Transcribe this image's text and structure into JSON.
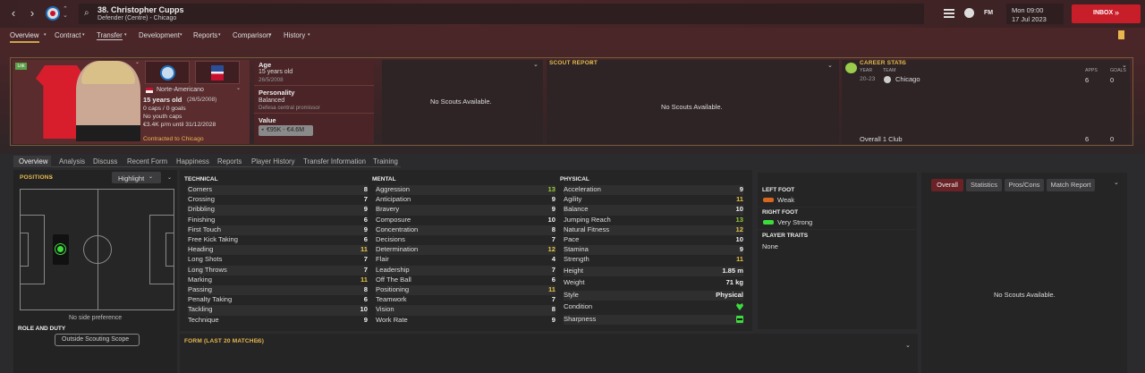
{
  "header": {
    "player_title": "38. Christopher Cupps",
    "player_subtitle": "Defender (Centre) - Chicago",
    "date_day": "Mon 09:00",
    "date_full": "17 Jul 2023",
    "inbox_label": "INBOX",
    "fm_label": "FM"
  },
  "menu": [
    "Overview",
    "Contract",
    "Transfer",
    "Development",
    "Reports",
    "Comparison",
    "History"
  ],
  "profile": {
    "nationality": "Norte-Americano",
    "age_line": "15 years old",
    "age_dob": "(26/5/2008)",
    "caps": "0 caps / 0 goals",
    "youth_caps": "No youth caps",
    "wage": "€3.4K p/m until 31/12/2028",
    "contract": "Contracted to Chicago",
    "badge": "Lnk"
  },
  "info": {
    "age_label": "Age",
    "age_value": "15 years old",
    "dob": "26/5/2008",
    "personality_label": "Personality",
    "personality_value": "Balanced",
    "personality_sub": "Defesa central promissor",
    "value_label": "Value",
    "value_range": "€95K - €4.6M"
  },
  "scouts": {
    "no_scouts_1": "No Scouts Available.",
    "scout_report_label": "SCOUT REPORT",
    "no_scouts_2": "No Scouts Available.",
    "no_scouts_3": "No Scouts Available."
  },
  "career": {
    "label": "CAREER STATS",
    "year_h": "YEAR",
    "team_h": "TEAM",
    "apps_h": "APPS",
    "goals_h": "GOALS",
    "year": "20-23",
    "team": "Chicago",
    "apps": "6",
    "goals": "0",
    "total_label": "Overall 1 Club",
    "total_apps": "6",
    "total_goals": "0"
  },
  "tabs": [
    "Overview",
    "Analysis",
    "Discuss",
    "Recent Form",
    "Happiness",
    "Reports",
    "Player History",
    "Transfer Information",
    "Training"
  ],
  "positions": {
    "label": "POSITIONS",
    "highlight": "Highlight",
    "no_side": "No side preference",
    "role_label": "ROLE AND DUTY",
    "scope_btn": "Outside Scouting Scope"
  },
  "technical": {
    "label": "TECHNICAL",
    "rows": [
      [
        "Corners",
        "8",
        "w"
      ],
      [
        "Crossing",
        "7",
        "w"
      ],
      [
        "Dribbling",
        "9",
        "w"
      ],
      [
        "Finishing",
        "6",
        "w"
      ],
      [
        "First Touch",
        "9",
        "w"
      ],
      [
        "Free Kick Taking",
        "6",
        "w"
      ],
      [
        "Heading",
        "11",
        "y"
      ],
      [
        "Long Shots",
        "7",
        "w"
      ],
      [
        "Long Throws",
        "7",
        "w"
      ],
      [
        "Marking",
        "11",
        "y"
      ],
      [
        "Passing",
        "8",
        "w"
      ],
      [
        "Penalty Taking",
        "6",
        "w"
      ],
      [
        "Tackling",
        "10",
        "w"
      ],
      [
        "Technique",
        "9",
        "w"
      ]
    ]
  },
  "mental": {
    "label": "MENTAL",
    "rows": [
      [
        "Aggression",
        "13",
        "g"
      ],
      [
        "Anticipation",
        "9",
        "w"
      ],
      [
        "Bravery",
        "9",
        "w"
      ],
      [
        "Composure",
        "10",
        "w"
      ],
      [
        "Concentration",
        "8",
        "w"
      ],
      [
        "Decisions",
        "7",
        "w"
      ],
      [
        "Determination",
        "12",
        "y"
      ],
      [
        "Flair",
        "4",
        "w"
      ],
      [
        "Leadership",
        "7",
        "w"
      ],
      [
        "Off The Ball",
        "6",
        "w"
      ],
      [
        "Positioning",
        "11",
        "y"
      ],
      [
        "Teamwork",
        "7",
        "w"
      ],
      [
        "Vision",
        "8",
        "w"
      ],
      [
        "Work Rate",
        "9",
        "w"
      ]
    ]
  },
  "physical": {
    "label": "PHYSICAL",
    "rows": [
      [
        "Acceleration",
        "9",
        "w"
      ],
      [
        "Agility",
        "11",
        "y"
      ],
      [
        "Balance",
        "10",
        "w"
      ],
      [
        "Jumping Reach",
        "13",
        "g"
      ],
      [
        "Natural Fitness",
        "12",
        "y"
      ],
      [
        "Pace",
        "10",
        "w"
      ],
      [
        "Stamina",
        "9",
        "w"
      ],
      [
        "Strength",
        "11",
        "y"
      ]
    ],
    "height_label": "Height",
    "height": "1.85 m",
    "weight_label": "Weight",
    "weight": "71 kg",
    "style_label": "Style",
    "style": "Physical",
    "condition_label": "Condition",
    "sharpness_label": "Sharpness"
  },
  "feet": {
    "left_label": "LEFT FOOT",
    "left_value": "Weak",
    "right_label": "RIGHT FOOT",
    "right_value": "Very Strong",
    "traits_label": "PLAYER TRAITS",
    "traits_value": "None"
  },
  "right_tabs": [
    "Overall",
    "Statistics",
    "Pros/Cons",
    "Match Report"
  ],
  "form_label": "FORM (LAST 20 MATCHES)",
  "colors": {
    "accent_red": "#c81e2a",
    "gold": "#e8b84c",
    "yellow": "#e6c246",
    "green": "#99cc33"
  }
}
